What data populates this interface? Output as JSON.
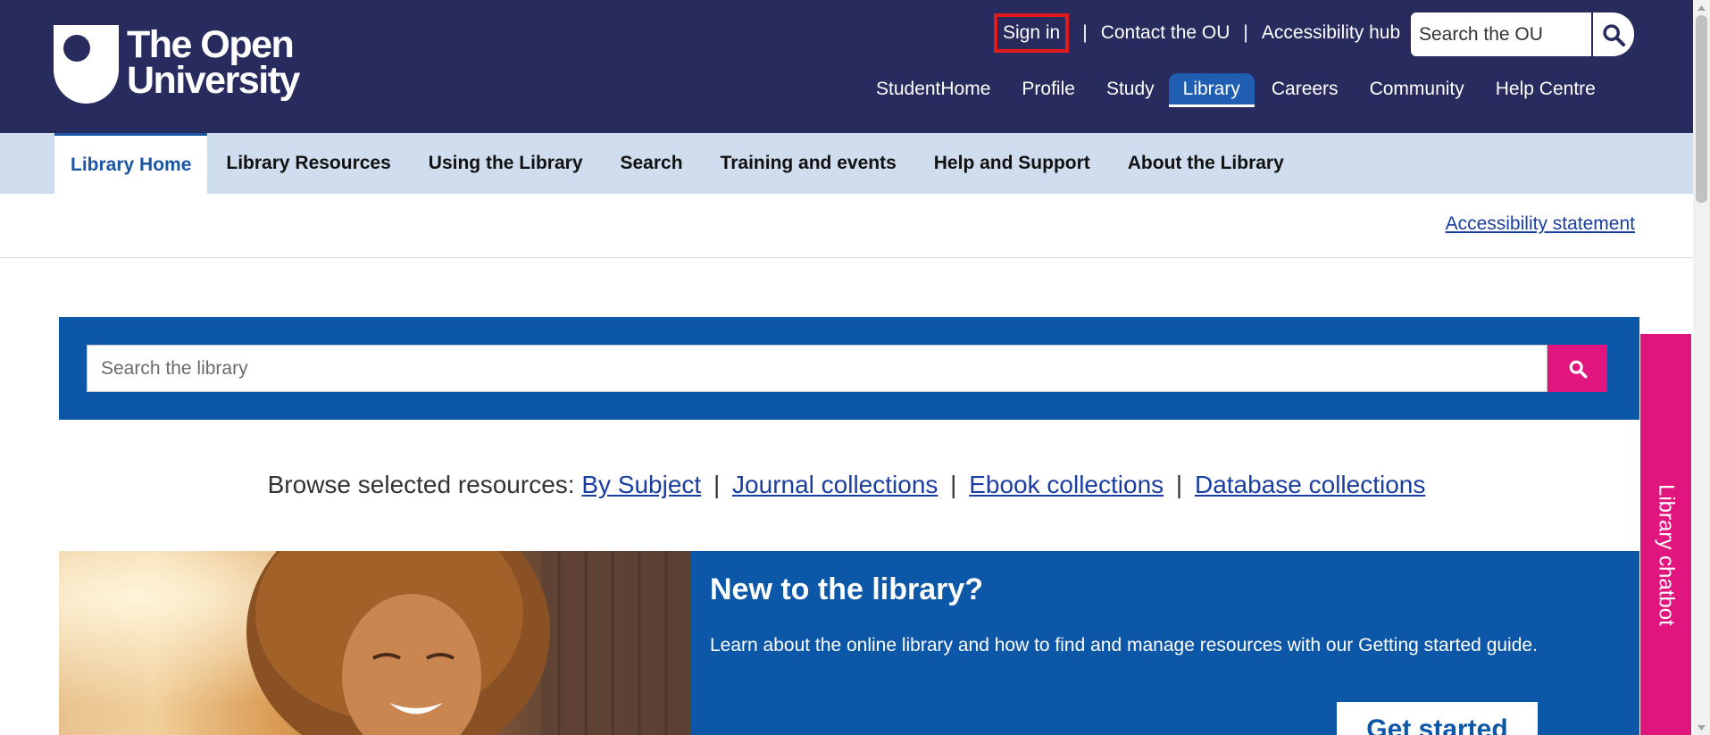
{
  "header": {
    "logo": {
      "line1": "The Open",
      "line2": "University",
      "shield_color": "#ffffff"
    },
    "utility_links": [
      {
        "label": "Sign in"
      },
      {
        "label": "Contact the OU"
      },
      {
        "label": "Accessibility hub"
      }
    ],
    "separator": "|",
    "search": {
      "placeholder": "Search the OU",
      "icon": "search-icon"
    },
    "main_nav": [
      {
        "label": "StudentHome"
      },
      {
        "label": "Profile"
      },
      {
        "label": "Study"
      },
      {
        "label": "Library",
        "active": true
      },
      {
        "label": "Careers"
      },
      {
        "label": "Community"
      },
      {
        "label": "Help Centre"
      }
    ],
    "colors": {
      "background": "#282b5e",
      "active_tab": "#1f5eb0",
      "highlight_box": "#e01b1b"
    }
  },
  "library_nav": {
    "tabs": [
      {
        "label": "Library Home",
        "active": true
      },
      {
        "label": "Library Resources"
      },
      {
        "label": "Using the Library"
      },
      {
        "label": "Search"
      },
      {
        "label": "Training and events"
      },
      {
        "label": "Help and Support"
      },
      {
        "label": "About the Library"
      }
    ],
    "colors": {
      "background": "#d0ddee",
      "active_text": "#1a56a4"
    }
  },
  "accessibility": {
    "link_label": "Accessibility statement"
  },
  "library_search": {
    "placeholder": "Search the library",
    "icon": "search-icon",
    "colors": {
      "panel": "#0c57a7",
      "button": "#e0157e"
    }
  },
  "browse": {
    "prefix": "Browse selected resources:",
    "separator": "|",
    "links": [
      {
        "label": "By Subject"
      },
      {
        "label": "Journal collections"
      },
      {
        "label": "Ebook collections"
      },
      {
        "label": "Database collections"
      }
    ]
  },
  "hero": {
    "title": "New to the library?",
    "text": "Learn about the online library and how to find and manage resources with our Getting started guide.",
    "button_label": "Get started",
    "image": "smiling-woman-photo"
  },
  "chatbot": {
    "label": "Library chatbot",
    "color": "#e0157e"
  }
}
